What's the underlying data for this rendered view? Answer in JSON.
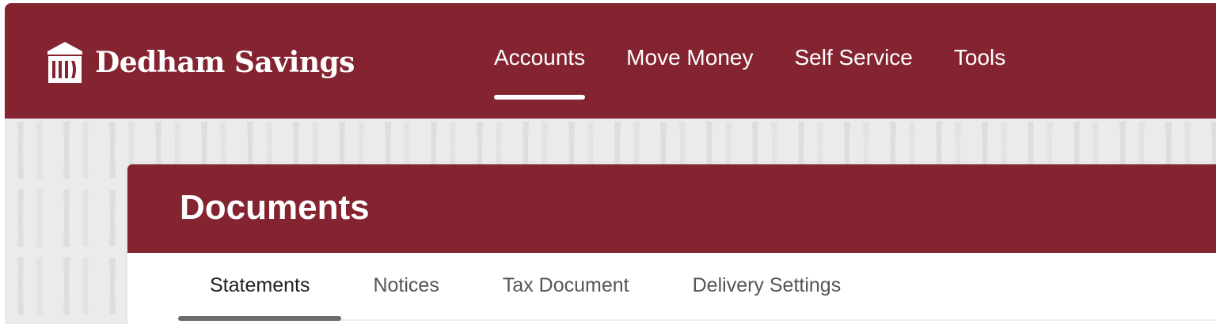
{
  "header": {
    "brand_name": "Dedham Savings",
    "logo_icon": "bank-column-logo",
    "nav": [
      {
        "label": "Accounts",
        "active": true
      },
      {
        "label": "Move Money",
        "active": false
      },
      {
        "label": "Self Service",
        "active": false
      },
      {
        "label": "Tools",
        "active": false
      }
    ]
  },
  "page": {
    "title": "Documents",
    "tabs": [
      {
        "label": "Statements",
        "active": true
      },
      {
        "label": "Notices",
        "active": false
      },
      {
        "label": "Tax Document",
        "active": false
      },
      {
        "label": "Delivery Settings",
        "active": false
      }
    ]
  },
  "colors": {
    "brand": "#852431",
    "background_pattern": "#ebebeb",
    "card": "#ffffff",
    "active_tab_indicator": "#6b6b6b"
  }
}
